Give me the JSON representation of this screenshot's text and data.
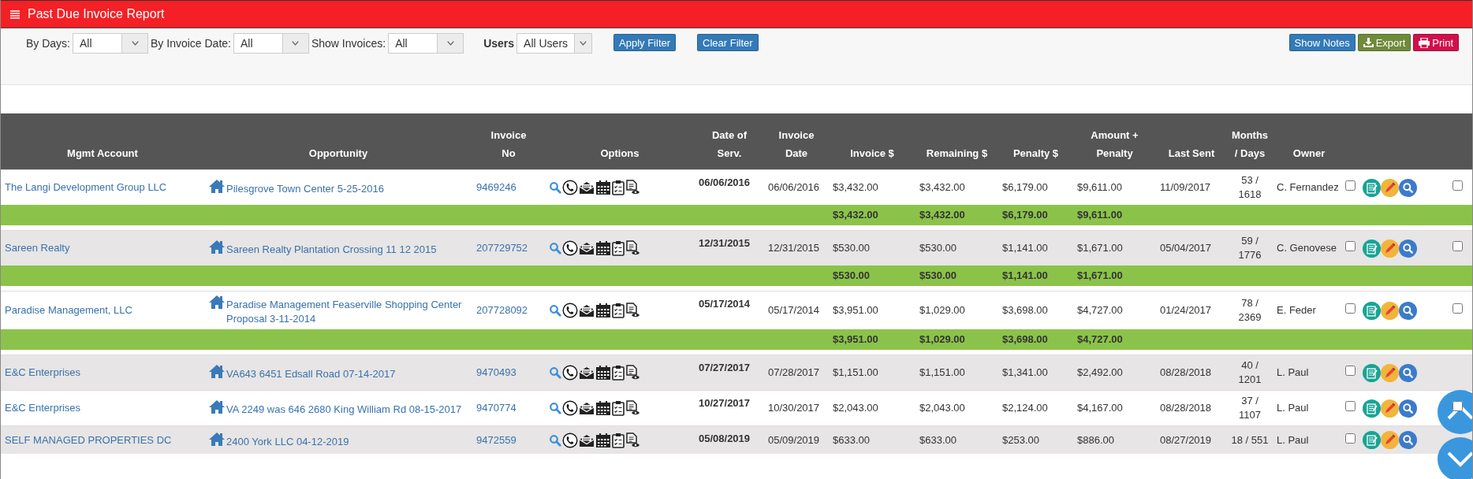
{
  "window": {
    "title": "Past Due Invoice Report"
  },
  "filters": [
    {
      "label": "By Days:",
      "value": "All",
      "kind": "plain"
    },
    {
      "label": "By Invoice Date:",
      "value": "All",
      "kind": "plain"
    },
    {
      "label": "Show Invoices:",
      "value": "All",
      "kind": "plain"
    },
    {
      "label": "Users",
      "value": "All Users",
      "kind": "bold"
    }
  ],
  "filter_buttons": [
    {
      "label": "Apply Filter",
      "kind": "primary"
    },
    {
      "label": "Clear Filter",
      "kind": "primary"
    }
  ],
  "action_buttons": [
    {
      "label": "Show Notes",
      "kind": "primary"
    },
    {
      "label": "Export",
      "kind": "export"
    },
    {
      "label": "Print",
      "kind": "print"
    }
  ],
  "table": {
    "columns": [
      "Mgmt Account",
      "Opportunity",
      "Invoice\nNo",
      "Options",
      "Date of\nServ.",
      "Invoice\nDate",
      "Invoice $",
      "Remaining $",
      "Penalty $",
      "Amount +\nPenalty",
      "Last Sent",
      "Months\n/ Days",
      "Owner"
    ],
    "rows": [
      {
        "account": "The Langi Development Group LLC",
        "opportunity": "Pilesgrove Town Center 5-25-2016",
        "invoice_no": "9469246",
        "date_of_serv": "06/06/2016",
        "invoice_date": "06/06/2016",
        "invoice_amount": "$3,432.00",
        "remaining": "$3,432.00",
        "penalty": "$6,179.00",
        "amount_penalty": "$9,611.00",
        "last_sent": "11/09/2017",
        "months_days": "53 / 1618",
        "owner": "C. Fernandez",
        "checkboxes": [
          {
            "checked": false
          },
          {
            "checked": false
          }
        ],
        "subtotal": [
          "$3,432.00",
          "$3,432.00",
          "$6,179.00",
          "$9,611.00"
        ]
      },
      {
        "account": "Sareen Realty",
        "opportunity": "Sareen Realty Plantation Crossing 11 12 2015",
        "invoice_no": "207729752",
        "date_of_serv": "12/31/2015",
        "invoice_date": "12/31/2015",
        "invoice_amount": "$530.00",
        "remaining": "$530.00",
        "penalty": "$1,141.00",
        "amount_penalty": "$1,671.00",
        "last_sent": "05/04/2017",
        "months_days": "59 / 1776",
        "owner": "C. Genovese",
        "checkboxes": [
          {
            "checked": false
          },
          {
            "checked": false
          }
        ],
        "subtotal": [
          "$530.00",
          "$530.00",
          "$1,141.00",
          "$1,671.00"
        ]
      },
      {
        "account": "Paradise Management, LLC",
        "opportunity": "Paradise Management Feaserville Shopping Center Proposal 3-11-2014",
        "invoice_no": "207728092",
        "date_of_serv": "05/17/2014",
        "invoice_date": "05/17/2014",
        "invoice_amount": "$3,951.00",
        "remaining": "$1,029.00",
        "penalty": "$3,698.00",
        "amount_penalty": "$4,727.00",
        "last_sent": "01/24/2017",
        "months_days": "78 / 2369",
        "owner": "E. Feder",
        "checkboxes": [
          {
            "checked": false
          },
          {
            "checked": false
          }
        ],
        "subtotal": [
          "$3,951.00",
          "$1,029.00",
          "$3,698.00",
          "$4,727.00"
        ]
      },
      {
        "account": "E&C Enterprises",
        "opportunity": "VA643 6451 Edsall Road 07-14-2017",
        "invoice_no": "9470493",
        "date_of_serv": "07/27/2017",
        "invoice_date": "07/28/2017",
        "invoice_amount": "$1,151.00",
        "remaining": "$1,151.00",
        "penalty": "$1,341.00",
        "amount_penalty": "$2,492.00",
        "last_sent": "08/28/2018",
        "months_days": "40 / 1201",
        "owner": "L. Paul",
        "checkboxes": [
          {
            "checked": false
          }
        ]
      },
      {
        "account": "E&C Enterprises",
        "opportunity": "VA 2249 was 646 2680 King William Rd 08-15-2017",
        "invoice_no": "9470774",
        "date_of_serv": "10/27/2017",
        "invoice_date": "10/30/2017",
        "invoice_amount": "$2,043.00",
        "remaining": "$2,043.00",
        "penalty": "$2,124.00",
        "amount_penalty": "$4,167.00",
        "last_sent": "08/28/2018",
        "months_days": "37 / 1107",
        "owner": "L. Paul",
        "checkboxes": [
          {
            "checked": false
          },
          {
            "checked": false
          }
        ]
      },
      {
        "account": "SELF MANAGED PROPERTIES DC",
        "opportunity": "2400 York LLC 04-12-2019",
        "invoice_no": "9472559",
        "date_of_serv": "05/08/2019",
        "invoice_date": "05/09/2019",
        "invoice_amount": "$633.00",
        "remaining": "$633.00",
        "penalty": "$253.00",
        "amount_penalty": "$886.00",
        "last_sent": "08/27/2019",
        "months_days": "18 / 551",
        "owner": "L. Paul",
        "checkboxes": [
          {
            "checked": false
          }
        ]
      }
    ]
  }
}
